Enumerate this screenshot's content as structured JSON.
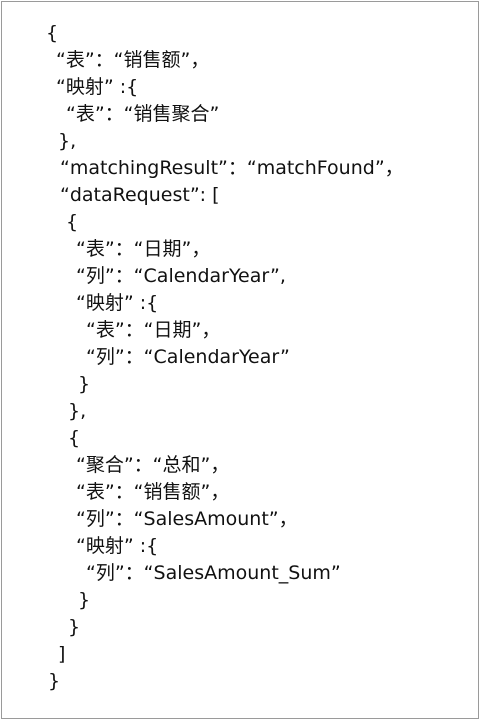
{
  "lines": [
    "{",
    "“表”：“销售额”，",
    "“映射” :{",
    "“表”：“销售聚合”",
    "},",
    "“matchingResult”：“matchFound”，",
    "“dataRequest”: [",
    "{",
    "“表”：“日期”，",
    "“列”：“CalendarYear”,",
    "“映射” :{",
    "“表”：“日期”，",
    "“列”：“CalendarYear”",
    "}",
    "},",
    "{",
    "“聚合”：“总和”，",
    "“表”：“销售额”，",
    "“列”：“SalesAmount”，",
    "“映射” :{",
    "“列”：“SalesAmount_Sum”",
    "}",
    "}",
    "]",
    "}"
  ]
}
